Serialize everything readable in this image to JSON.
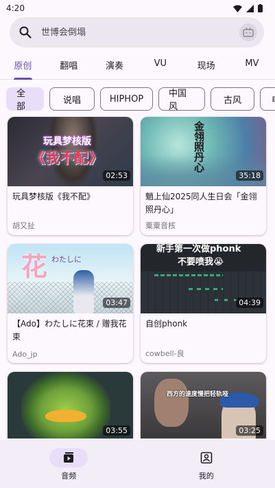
{
  "status": {
    "time": "4:20"
  },
  "search": {
    "placeholder": "世博会倒塌"
  },
  "tabs": [
    {
      "label": "原创"
    },
    {
      "label": "翻唱"
    },
    {
      "label": "演奏"
    },
    {
      "label": "VU"
    },
    {
      "label": "现场"
    },
    {
      "label": "MV"
    }
  ],
  "chips": [
    {
      "label": "全部"
    },
    {
      "label": "说唱"
    },
    {
      "label": "HIPHOP"
    },
    {
      "label": "中国风"
    },
    {
      "label": "古风"
    },
    {
      "label": "电音"
    }
  ],
  "videos": [
    {
      "title": "玩具梦核版《我不配》",
      "author": "胡又扯",
      "duration": "02:53",
      "overlay_line1": "玩具梦核版",
      "overlay_line2": "《我不配》"
    },
    {
      "title": "魈上仙2025同人生日会「金翎照丹心」",
      "author": "粟粟音核",
      "duration": "35:18",
      "overlay_line1": "金翎照丹心"
    },
    {
      "title": "【Ado】わたしに花束 / 赠我花束",
      "author": "Ado_jp",
      "duration": "03:47",
      "overlay_line1": "花",
      "overlay_line2": "わたしに"
    },
    {
      "title": "自创phonk",
      "author": "cowbell-良",
      "duration": "04:39",
      "overlay_line1": "新手第一次做phonk",
      "overlay_line2": "不要喷我😭"
    },
    {
      "title": "",
      "author": "",
      "duration": "03:55"
    },
    {
      "title": "",
      "author": "",
      "duration": "03:25",
      "overlay_line1": "西方的速度慢把轻轨哑"
    }
  ],
  "nav": [
    {
      "label": "音频",
      "icon": "play-icon"
    },
    {
      "label": "我的",
      "icon": "profile-icon"
    }
  ],
  "colors": {
    "primary": "#6750a4",
    "chip_selected": "#e8def8",
    "nav_bg": "#f3edf7"
  }
}
